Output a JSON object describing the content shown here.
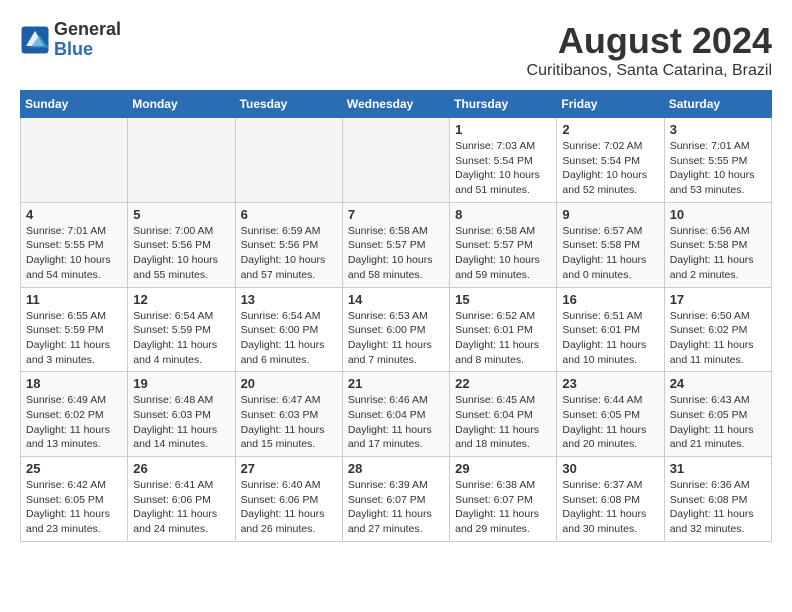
{
  "header": {
    "logo_general": "General",
    "logo_blue": "Blue",
    "month_title": "August 2024",
    "location": "Curitibanos, Santa Catarina, Brazil"
  },
  "weekdays": [
    "Sunday",
    "Monday",
    "Tuesday",
    "Wednesday",
    "Thursday",
    "Friday",
    "Saturday"
  ],
  "weeks": [
    [
      {
        "day": "",
        "empty": true
      },
      {
        "day": "",
        "empty": true
      },
      {
        "day": "",
        "empty": true
      },
      {
        "day": "",
        "empty": true
      },
      {
        "day": "1",
        "sunrise": "Sunrise: 7:03 AM",
        "sunset": "Sunset: 5:54 PM",
        "daylight": "Daylight: 10 hours and 51 minutes."
      },
      {
        "day": "2",
        "sunrise": "Sunrise: 7:02 AM",
        "sunset": "Sunset: 5:54 PM",
        "daylight": "Daylight: 10 hours and 52 minutes."
      },
      {
        "day": "3",
        "sunrise": "Sunrise: 7:01 AM",
        "sunset": "Sunset: 5:55 PM",
        "daylight": "Daylight: 10 hours and 53 minutes."
      }
    ],
    [
      {
        "day": "4",
        "sunrise": "Sunrise: 7:01 AM",
        "sunset": "Sunset: 5:55 PM",
        "daylight": "Daylight: 10 hours and 54 minutes."
      },
      {
        "day": "5",
        "sunrise": "Sunrise: 7:00 AM",
        "sunset": "Sunset: 5:56 PM",
        "daylight": "Daylight: 10 hours and 55 minutes."
      },
      {
        "day": "6",
        "sunrise": "Sunrise: 6:59 AM",
        "sunset": "Sunset: 5:56 PM",
        "daylight": "Daylight: 10 hours and 57 minutes."
      },
      {
        "day": "7",
        "sunrise": "Sunrise: 6:58 AM",
        "sunset": "Sunset: 5:57 PM",
        "daylight": "Daylight: 10 hours and 58 minutes."
      },
      {
        "day": "8",
        "sunrise": "Sunrise: 6:58 AM",
        "sunset": "Sunset: 5:57 PM",
        "daylight": "Daylight: 10 hours and 59 minutes."
      },
      {
        "day": "9",
        "sunrise": "Sunrise: 6:57 AM",
        "sunset": "Sunset: 5:58 PM",
        "daylight": "Daylight: 11 hours and 0 minutes."
      },
      {
        "day": "10",
        "sunrise": "Sunrise: 6:56 AM",
        "sunset": "Sunset: 5:58 PM",
        "daylight": "Daylight: 11 hours and 2 minutes."
      }
    ],
    [
      {
        "day": "11",
        "sunrise": "Sunrise: 6:55 AM",
        "sunset": "Sunset: 5:59 PM",
        "daylight": "Daylight: 11 hours and 3 minutes."
      },
      {
        "day": "12",
        "sunrise": "Sunrise: 6:54 AM",
        "sunset": "Sunset: 5:59 PM",
        "daylight": "Daylight: 11 hours and 4 minutes."
      },
      {
        "day": "13",
        "sunrise": "Sunrise: 6:54 AM",
        "sunset": "Sunset: 6:00 PM",
        "daylight": "Daylight: 11 hours and 6 minutes."
      },
      {
        "day": "14",
        "sunrise": "Sunrise: 6:53 AM",
        "sunset": "Sunset: 6:00 PM",
        "daylight": "Daylight: 11 hours and 7 minutes."
      },
      {
        "day": "15",
        "sunrise": "Sunrise: 6:52 AM",
        "sunset": "Sunset: 6:01 PM",
        "daylight": "Daylight: 11 hours and 8 minutes."
      },
      {
        "day": "16",
        "sunrise": "Sunrise: 6:51 AM",
        "sunset": "Sunset: 6:01 PM",
        "daylight": "Daylight: 11 hours and 10 minutes."
      },
      {
        "day": "17",
        "sunrise": "Sunrise: 6:50 AM",
        "sunset": "Sunset: 6:02 PM",
        "daylight": "Daylight: 11 hours and 11 minutes."
      }
    ],
    [
      {
        "day": "18",
        "sunrise": "Sunrise: 6:49 AM",
        "sunset": "Sunset: 6:02 PM",
        "daylight": "Daylight: 11 hours and 13 minutes."
      },
      {
        "day": "19",
        "sunrise": "Sunrise: 6:48 AM",
        "sunset": "Sunset: 6:03 PM",
        "daylight": "Daylight: 11 hours and 14 minutes."
      },
      {
        "day": "20",
        "sunrise": "Sunrise: 6:47 AM",
        "sunset": "Sunset: 6:03 PM",
        "daylight": "Daylight: 11 hours and 15 minutes."
      },
      {
        "day": "21",
        "sunrise": "Sunrise: 6:46 AM",
        "sunset": "Sunset: 6:04 PM",
        "daylight": "Daylight: 11 hours and 17 minutes."
      },
      {
        "day": "22",
        "sunrise": "Sunrise: 6:45 AM",
        "sunset": "Sunset: 6:04 PM",
        "daylight": "Daylight: 11 hours and 18 minutes."
      },
      {
        "day": "23",
        "sunrise": "Sunrise: 6:44 AM",
        "sunset": "Sunset: 6:05 PM",
        "daylight": "Daylight: 11 hours and 20 minutes."
      },
      {
        "day": "24",
        "sunrise": "Sunrise: 6:43 AM",
        "sunset": "Sunset: 6:05 PM",
        "daylight": "Daylight: 11 hours and 21 minutes."
      }
    ],
    [
      {
        "day": "25",
        "sunrise": "Sunrise: 6:42 AM",
        "sunset": "Sunset: 6:05 PM",
        "daylight": "Daylight: 11 hours and 23 minutes."
      },
      {
        "day": "26",
        "sunrise": "Sunrise: 6:41 AM",
        "sunset": "Sunset: 6:06 PM",
        "daylight": "Daylight: 11 hours and 24 minutes."
      },
      {
        "day": "27",
        "sunrise": "Sunrise: 6:40 AM",
        "sunset": "Sunset: 6:06 PM",
        "daylight": "Daylight: 11 hours and 26 minutes."
      },
      {
        "day": "28",
        "sunrise": "Sunrise: 6:39 AM",
        "sunset": "Sunset: 6:07 PM",
        "daylight": "Daylight: 11 hours and 27 minutes."
      },
      {
        "day": "29",
        "sunrise": "Sunrise: 6:38 AM",
        "sunset": "Sunset: 6:07 PM",
        "daylight": "Daylight: 11 hours and 29 minutes."
      },
      {
        "day": "30",
        "sunrise": "Sunrise: 6:37 AM",
        "sunset": "Sunset: 6:08 PM",
        "daylight": "Daylight: 11 hours and 30 minutes."
      },
      {
        "day": "31",
        "sunrise": "Sunrise: 6:36 AM",
        "sunset": "Sunset: 6:08 PM",
        "daylight": "Daylight: 11 hours and 32 minutes."
      }
    ]
  ]
}
